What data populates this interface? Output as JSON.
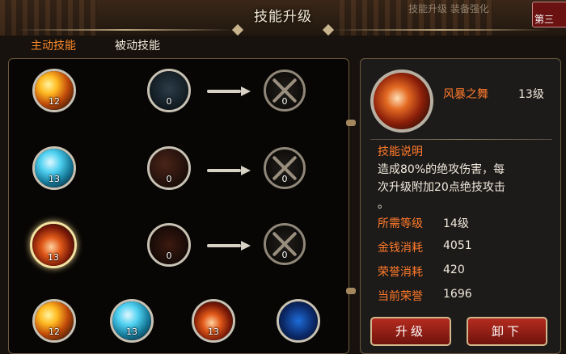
{
  "header": {
    "title": "技能升级",
    "top_right_faint": "技能升级  装备强化",
    "corner_button_label": "第三"
  },
  "tabs": [
    {
      "label": "主动技能",
      "active": true
    },
    {
      "label": "被动技能",
      "active": false
    }
  ],
  "skill_rows": [
    {
      "current": {
        "type": "fire",
        "level": "12"
      },
      "next": {
        "level": "0"
      },
      "target": {
        "level": "0"
      }
    },
    {
      "current": {
        "type": "ice",
        "level": "13"
      },
      "next": {
        "level": "0"
      },
      "target": {
        "level": "0"
      }
    },
    {
      "current": {
        "type": "storm",
        "level": "13",
        "selected": true
      },
      "next": {
        "level": "0"
      },
      "target": {
        "level": "0"
      }
    }
  ],
  "equipped_skills": [
    {
      "type": "fire",
      "level": "12"
    },
    {
      "type": "ice",
      "level": "13"
    },
    {
      "type": "storm",
      "level": "13"
    },
    {
      "type": "blue",
      "level": ""
    }
  ],
  "detail": {
    "name": "风暴之舞",
    "level": "13级",
    "desc_title": "技能说明",
    "desc_lines": [
      "造成80%的绝攻伤害，每",
      "次升级附加20点绝技攻击",
      "。"
    ],
    "stats": [
      {
        "label": "所需等级",
        "value": "14级"
      },
      {
        "label": "金钱消耗",
        "value": "4051"
      },
      {
        "label": "荣誉消耗",
        "value": "420"
      },
      {
        "label": "当前荣誉",
        "value": "1696"
      }
    ]
  },
  "buttons": {
    "upgrade": "升级",
    "unequip": "卸下"
  },
  "colors": {
    "accent_orange": "#ff7a2a",
    "button_red": "#b52b1f",
    "panel_border": "#6c5a40"
  }
}
